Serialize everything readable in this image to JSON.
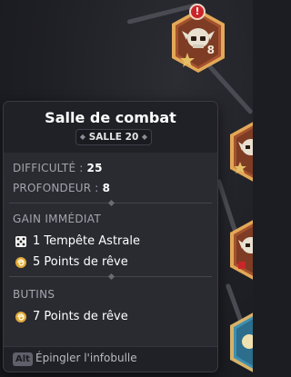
{
  "tooltip": {
    "title": "Salle de combat",
    "subtitle": "SALLE 20",
    "stats": [
      {
        "label": "DIFFICULTÉ :",
        "value": "25"
      },
      {
        "label": "PROFONDEUR :",
        "value": "8"
      }
    ],
    "immediate": {
      "title": "GAIN IMMÉDIAT",
      "items": [
        {
          "icon": "dice-icon",
          "text": "1 Tempête Astrale"
        },
        {
          "icon": "dream-points-icon",
          "text": "5 Points de rêve"
        }
      ]
    },
    "loot": {
      "title": "BUTINS",
      "items": [
        {
          "icon": "dream-points-icon",
          "text": "7 Points de rêve"
        }
      ]
    },
    "footer": {
      "key": "Alt",
      "text": "Épingler l'infobulle"
    }
  },
  "map": {
    "active_node": {
      "count": "8",
      "alert": "!"
    },
    "colors": {
      "node_border": "#d99a4a",
      "node_fill": "#a8552e",
      "alert": "#c9262b",
      "path": "#4a4a52"
    }
  }
}
